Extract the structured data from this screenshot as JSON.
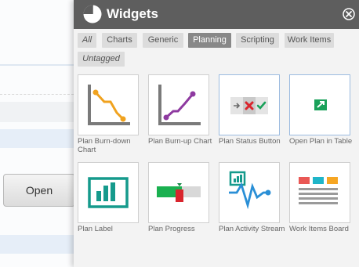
{
  "background": {
    "open_button_label": "Open"
  },
  "panel": {
    "title": "Widgets",
    "logo_icon": "pie-chart-icon",
    "close_icon": "close-circle-icon",
    "tabs": [
      {
        "label": "All",
        "active": false
      },
      {
        "label": "Charts",
        "active": false
      },
      {
        "label": "Generic",
        "active": false
      },
      {
        "label": "Planning",
        "active": true
      },
      {
        "label": "Scripting",
        "active": false
      },
      {
        "label": "Work Items",
        "active": false
      },
      {
        "label": "Untagged",
        "active": false
      }
    ],
    "widgets": [
      {
        "label": "Plan Burn-down Chart",
        "icon": "burndown-chart-icon"
      },
      {
        "label": "Plan Burn-up Chart",
        "icon": "burnup-chart-icon"
      },
      {
        "label": "Plan Status Button",
        "icon": "status-button-icon"
      },
      {
        "label": "Open Plan in Table",
        "icon": "open-table-icon"
      },
      {
        "label": "Plan Label",
        "icon": "plan-label-icon"
      },
      {
        "label": "Plan Progress",
        "icon": "progress-icon"
      },
      {
        "label": "Plan Activity Stream",
        "icon": "activity-stream-icon"
      },
      {
        "label": "Work Items Board",
        "icon": "board-icon"
      }
    ]
  }
}
